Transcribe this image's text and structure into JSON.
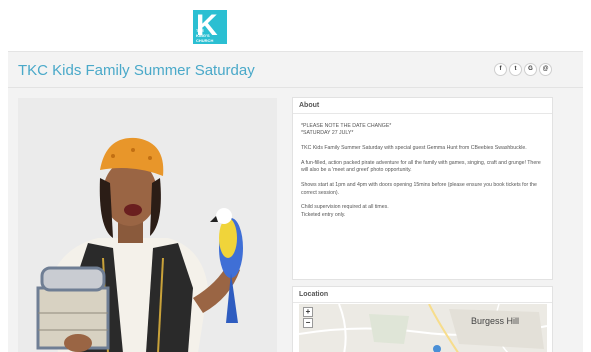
{
  "header": {
    "logo_letter": "K",
    "logo_sub": "THE KING'S CHURCH"
  },
  "page": {
    "title": "TKC Kids Family Summer Saturday"
  },
  "social": [
    {
      "icon": "facebook-icon",
      "glyph": "f"
    },
    {
      "icon": "twitter-icon",
      "glyph": "t"
    },
    {
      "icon": "google-plus-icon",
      "glyph": "G"
    },
    {
      "icon": "email-icon",
      "glyph": "@"
    }
  ],
  "about": {
    "heading": "About",
    "paragraphs": [
      "*PLEASE NOTE THE DATE CHANGE*\n*SATURDAY 27 JULY*",
      "TKC Kids Family Summer Saturday with special guest Gemma Hunt from CBeebies Swashbuckle.",
      "A fun-filled, action packed pirate adventure for all the family with games, singing, craft and grunge! There will also be a 'meet and greet' photo opportunity.",
      "Shows start at 1pm and 4pm with doors opening 15mins before (please ensure you book tickets for the correct session).",
      "Child supervision required at all times.\nTicketed entry only."
    ]
  },
  "location": {
    "heading": "Location",
    "zoom_in": "+",
    "zoom_out": "−",
    "map_label": "Burgess Hill"
  },
  "colors": {
    "accent": "#4aa9c9",
    "logo": "#2bbfd2",
    "hat": "#e8962a",
    "parrot_blue": "#3f6fd6",
    "parrot_yellow": "#f0d43a"
  }
}
